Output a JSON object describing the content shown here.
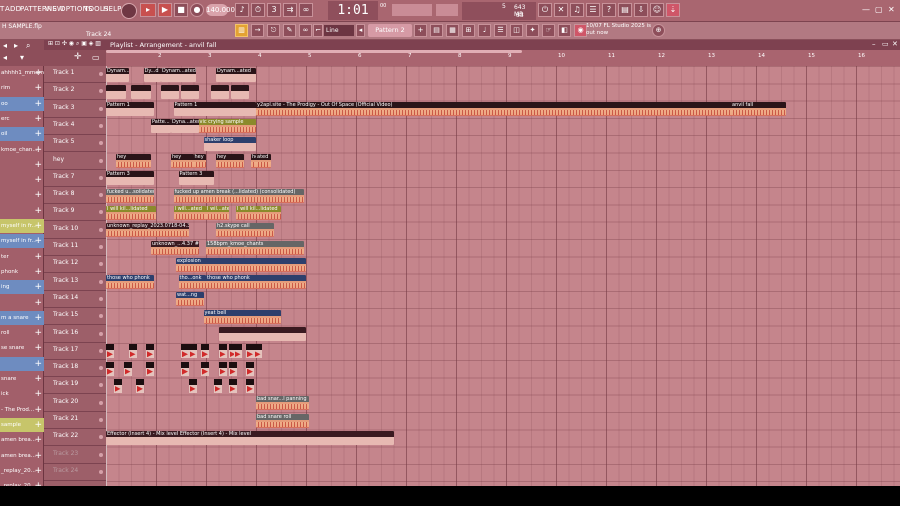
{
  "menu": [
    "T",
    "ADD",
    "PATTERNS",
    "VIEW",
    "OPTIONS",
    "TOOLS",
    "HELP"
  ],
  "transport": {
    "tempo": "140.000",
    "time": "1:01",
    "time_frac": "00",
    "time_sub": "B:S:T"
  },
  "cpu": {
    "value1": "5",
    "mem": "643 MB",
    "value2": "83"
  },
  "news": {
    "line1": "10/07  FL Studio 2025 is",
    "line2": "out now"
  },
  "project": {
    "file_name": "H SAMPLE.flp",
    "track_hint": "Track 24"
  },
  "snap": "Line",
  "pattern_selected": "Pattern 2",
  "playlist": {
    "title": "Playlist - Arrangement",
    "arrangement": "anvil fall",
    "bar_numbers": [
      "2",
      "3",
      "4",
      "5",
      "6",
      "7",
      "8",
      "9",
      "10",
      "11",
      "12",
      "13",
      "14",
      "15",
      "16"
    ]
  },
  "browser": {
    "items": [
      {
        "label": "ahhhh1_mmamp_0.m",
        "style": ""
      },
      {
        "label": "rim",
        "style": ""
      },
      {
        "label": "oo",
        "style": "hl"
      },
      {
        "label": "erc",
        "style": ""
      },
      {
        "label": "oil",
        "style": "hl"
      },
      {
        "label": "kmoe_chan...",
        "style": ""
      },
      {
        "label": "",
        "style": ""
      },
      {
        "label": "",
        "style": ""
      },
      {
        "label": "",
        "style": ""
      },
      {
        "label": "",
        "style": ""
      },
      {
        "label": "myself in fr...",
        "style": "yl"
      },
      {
        "label": "myself in fr...",
        "style": "hl"
      },
      {
        "label": "ter",
        "style": ""
      },
      {
        "label": "phonk",
        "style": ""
      },
      {
        "label": "ing",
        "style": "hl"
      },
      {
        "label": "",
        "style": ""
      },
      {
        "label": "m a snare",
        "style": "hl"
      },
      {
        "label": "roll",
        "style": ""
      },
      {
        "label": "se snare",
        "style": ""
      },
      {
        "label": "",
        "style": "hl"
      },
      {
        "label": "snare",
        "style": ""
      },
      {
        "label": "ick",
        "style": ""
      },
      {
        "label": "- The Prod...",
        "style": ""
      },
      {
        "label": "sample",
        "style": "yl"
      },
      {
        "label": "amen brea...",
        "style": ""
      },
      {
        "label": "amen brea...",
        "style": ""
      },
      {
        "label": "_replay_20...",
        "style": ""
      },
      {
        "label": "_replay_20...",
        "style": ""
      }
    ]
  },
  "tracks": [
    {
      "name": "Track 1",
      "dim": false
    },
    {
      "name": "Track 2",
      "dim": false
    },
    {
      "name": "Track 3",
      "dim": false
    },
    {
      "name": "Track 4",
      "dim": false
    },
    {
      "name": "Track 5",
      "dim": false
    },
    {
      "name": "hey",
      "dim": false
    },
    {
      "name": "Track 7",
      "dim": false
    },
    {
      "name": "Track 8",
      "dim": false
    },
    {
      "name": "Track 9",
      "dim": false
    },
    {
      "name": "Track 10",
      "dim": false
    },
    {
      "name": "Track 11",
      "dim": false
    },
    {
      "name": "Track 12",
      "dim": false
    },
    {
      "name": "Track 13",
      "dim": false
    },
    {
      "name": "Track 14",
      "dim": false
    },
    {
      "name": "Track 15",
      "dim": false
    },
    {
      "name": "Track 16",
      "dim": false
    },
    {
      "name": "Track 17",
      "dim": false
    },
    {
      "name": "Track 18",
      "dim": false
    },
    {
      "name": "Track 19",
      "dim": false
    },
    {
      "name": "Track 20",
      "dim": false
    },
    {
      "name": "Track 21",
      "dim": false
    },
    {
      "name": "Track 22",
      "dim": false
    },
    {
      "name": "Track 23",
      "dim": true
    },
    {
      "name": "Track 24",
      "dim": true
    }
  ],
  "clips": [
    {
      "track": 0,
      "start": 1.0,
      "len": 0.45,
      "label": "Dynam...ated",
      "kind": "pattern"
    },
    {
      "track": 0,
      "start": 1.75,
      "len": 0.35,
      "label": "Dy...d",
      "kind": "pattern"
    },
    {
      "track": 0,
      "start": 2.1,
      "len": 0.7,
      "label": "Dynam...ated",
      "kind": "pattern"
    },
    {
      "track": 0,
      "start": 3.2,
      "len": 0.8,
      "label": "Dynam...ated",
      "kind": "pattern"
    },
    {
      "track": 1,
      "start": 1.0,
      "len": 0.4,
      "label": "",
      "kind": "pattern"
    },
    {
      "track": 1,
      "start": 1.5,
      "len": 0.4,
      "label": "",
      "kind": "pattern"
    },
    {
      "track": 1,
      "start": 2.1,
      "len": 0.35,
      "label": "",
      "kind": "pattern"
    },
    {
      "track": 1,
      "start": 2.5,
      "len": 0.35,
      "label": "",
      "kind": "pattern"
    },
    {
      "track": 1,
      "start": 3.1,
      "len": 0.35,
      "label": "",
      "kind": "pattern"
    },
    {
      "track": 1,
      "start": 3.5,
      "len": 0.35,
      "label": "",
      "kind": "pattern"
    },
    {
      "track": 2,
      "start": 1.0,
      "len": 0.95,
      "label": "Pattern 1",
      "kind": "pattern"
    },
    {
      "track": 2,
      "start": 2.35,
      "len": 1.65,
      "label": "Pattern 1",
      "kind": "pattern"
    },
    {
      "track": 2,
      "start": 4.0,
      "len": 9.6,
      "label": "y2apl.site - The Prodigy - Out Of Space (Official Video)",
      "kind": "audio"
    },
    {
      "track": 2,
      "start": 13.5,
      "len": 1.1,
      "label": "anvil fall",
      "kind": "audio"
    },
    {
      "track": 3,
      "start": 1.9,
      "len": 0.4,
      "label": "Patte...",
      "kind": "pattern"
    },
    {
      "track": 3,
      "start": 2.3,
      "len": 0.55,
      "label": "Dyna...ated",
      "kind": "pattern"
    },
    {
      "track": 3,
      "start": 2.85,
      "len": 1.15,
      "label": "vic crying sample",
      "kind": "audio",
      "tone": "olive"
    },
    {
      "track": 4,
      "start": 2.95,
      "len": 1.05,
      "label": "shaker loop",
      "kind": "pattern",
      "tone": "blue"
    },
    {
      "track": 5,
      "start": 1.2,
      "len": 0.7,
      "label": "hey",
      "kind": "audio"
    },
    {
      "track": 5,
      "start": 2.3,
      "len": 0.45,
      "label": "hey",
      "kind": "audio"
    },
    {
      "track": 5,
      "start": 2.75,
      "len": 0.25,
      "label": "hey",
      "kind": "audio"
    },
    {
      "track": 5,
      "start": 3.2,
      "len": 0.55,
      "label": "hey",
      "kind": "audio"
    },
    {
      "track": 5,
      "start": 3.9,
      "len": 0.4,
      "label": "hey",
      "kind": "audio"
    },
    {
      "track": 5,
      "start": 4.0,
      "len": 0.25,
      "label": "ated",
      "kind": "audio"
    },
    {
      "track": 6,
      "start": 1.0,
      "len": 0.95,
      "label": "Pattern 3",
      "kind": "pattern"
    },
    {
      "track": 6,
      "start": 2.45,
      "len": 0.7,
      "label": "Pattern 3",
      "kind": "pattern"
    },
    {
      "track": 7,
      "start": 1.0,
      "len": 0.95,
      "label": "fucked u...solidated",
      "kind": "audio",
      "tone": "grey"
    },
    {
      "track": 7,
      "start": 2.35,
      "len": 2.6,
      "label": "fucked up amen break (...lidated) (consolidated)",
      "kind": "audio",
      "tone": "grey"
    },
    {
      "track": 8,
      "start": 1.0,
      "len": 1.0,
      "label": "I will kil...lidated",
      "kind": "audio",
      "tone": "olive"
    },
    {
      "track": 8,
      "start": 2.35,
      "len": 0.65,
      "label": "I will...ated",
      "kind": "audio",
      "tone": "olive"
    },
    {
      "track": 8,
      "start": 3.0,
      "len": 0.45,
      "label": "I wil...ated",
      "kind": "audio",
      "tone": "olive"
    },
    {
      "track": 8,
      "start": 3.6,
      "len": 0.9,
      "label": "I will kil...lidated",
      "kind": "audio",
      "tone": "olive"
    },
    {
      "track": 9,
      "start": 1.0,
      "len": 1.65,
      "label": "unknown_replay_2023.0718-04.37",
      "kind": "audio",
      "tone": "dark"
    },
    {
      "track": 9,
      "start": 3.2,
      "len": 1.15,
      "label": "h2.skype call",
      "kind": "audio",
      "tone": "grey"
    },
    {
      "track": 10,
      "start": 1.9,
      "len": 0.95,
      "label": "unknown_...4.37 #2",
      "kind": "audio",
      "tone": "dark"
    },
    {
      "track": 10,
      "start": 3.0,
      "len": 1.95,
      "label": "158bpm_kmoe_chants",
      "kind": "audio",
      "tone": "grey"
    },
    {
      "track": 11,
      "start": 2.4,
      "len": 2.6,
      "label": "explosion",
      "kind": "audio",
      "tone": "blue"
    },
    {
      "track": 12,
      "start": 1.0,
      "len": 0.95,
      "label": "those who phonk",
      "kind": "audio",
      "tone": "blue"
    },
    {
      "track": 12,
      "start": 2.45,
      "len": 0.55,
      "label": "tho...onk",
      "kind": "audio",
      "tone": "blue"
    },
    {
      "track": 12,
      "start": 3.0,
      "len": 2.0,
      "label": "those who phonk",
      "kind": "audio",
      "tone": "blue"
    },
    {
      "track": 13,
      "start": 2.4,
      "len": 0.55,
      "label": "wat...ng",
      "kind": "audio",
      "tone": "blue"
    },
    {
      "track": 14,
      "start": 2.95,
      "len": 1.55,
      "label": "yeat bell",
      "kind": "audio",
      "tone": "blue"
    },
    {
      "track": 15,
      "start": 3.25,
      "len": 1.75,
      "label": "",
      "kind": "pattern",
      "tone": "dark"
    },
    {
      "track": 19,
      "start": 4.0,
      "len": 1.05,
      "label": "bad snar...l panning",
      "kind": "audio",
      "tone": "grey"
    },
    {
      "track": 20,
      "start": 4.0,
      "len": 1.05,
      "label": "bad snare roll",
      "kind": "audio",
      "tone": "grey"
    },
    {
      "track": 21,
      "start": 1.0,
      "len": 5.75,
      "label": "Effector (Insert 4) - Mix level  Effector (Insert 4) - Mix level",
      "kind": "pattern",
      "tone": "dark"
    }
  ],
  "drum_rows": [
    {
      "track": 16,
      "starts": [
        1.0,
        1.45,
        1.8,
        2.5,
        2.65,
        2.9,
        3.25,
        3.45,
        3.55,
        3.8,
        3.95
      ]
    },
    {
      "track": 17,
      "starts": [
        1.0,
        1.35,
        1.8,
        2.5,
        2.9,
        3.25,
        3.45,
        3.8
      ]
    },
    {
      "track": 18,
      "starts": [
        1.15,
        1.6,
        2.65,
        3.15,
        3.45,
        3.8
      ]
    }
  ]
}
